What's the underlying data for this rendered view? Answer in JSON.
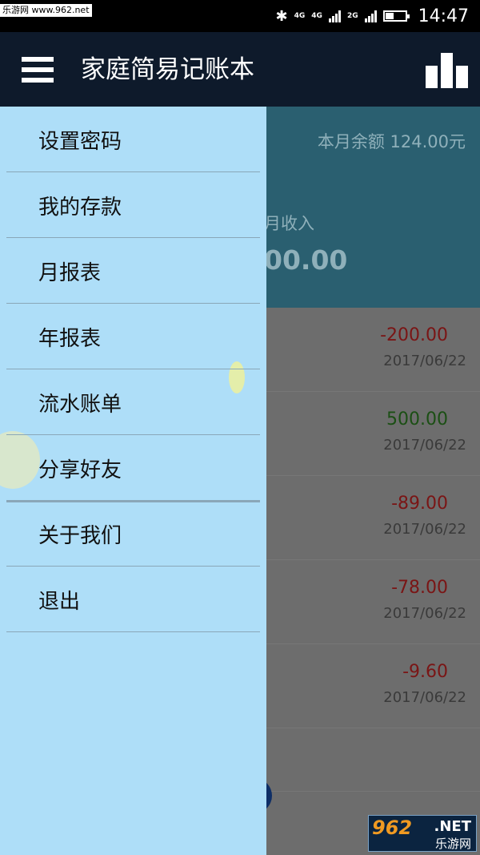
{
  "status_bar": {
    "watermark": "乐游网 www.962.net",
    "network_left": "4G",
    "network_mid": "4G",
    "network_right": "2G",
    "time": "14:47",
    "battery_level": 0.45
  },
  "app_bar": {
    "title": "家庭简易记账本",
    "menu_icon": "hamburger-menu-icon",
    "chart_icon": "bar-chart-icon"
  },
  "summary": {
    "balance": "本月余额 124.00元",
    "income_label": "月收入",
    "income_value": "00.00"
  },
  "records": [
    {
      "amount": "-200.00",
      "date": "2017/06/22",
      "type": "expense"
    },
    {
      "amount": "500.00",
      "date": "2017/06/22",
      "type": "income"
    },
    {
      "amount": "-89.00",
      "date": "2017/06/22",
      "type": "expense"
    },
    {
      "amount": "-78.00",
      "date": "2017/06/22",
      "type": "expense"
    },
    {
      "amount": "-9.60",
      "date": "2017/06/22",
      "type": "expense"
    }
  ],
  "drawer": {
    "items": [
      {
        "label": "设置密码"
      },
      {
        "label": "我的存款"
      },
      {
        "label": "月报表"
      },
      {
        "label": "年报表"
      },
      {
        "label": "流水账单"
      },
      {
        "label": "分享好友"
      },
      {
        "label": "关于我们"
      },
      {
        "label": "退出"
      }
    ]
  },
  "watermark_bottom": {
    "logo": "962",
    "net": ".NET",
    "name": "乐游网"
  },
  "colors": {
    "app_bar": "#0e1a2b",
    "drawer": "#aedef8",
    "summary_bg": "#2a5f70",
    "expense": "#7a1515",
    "income": "#1b4f14"
  }
}
